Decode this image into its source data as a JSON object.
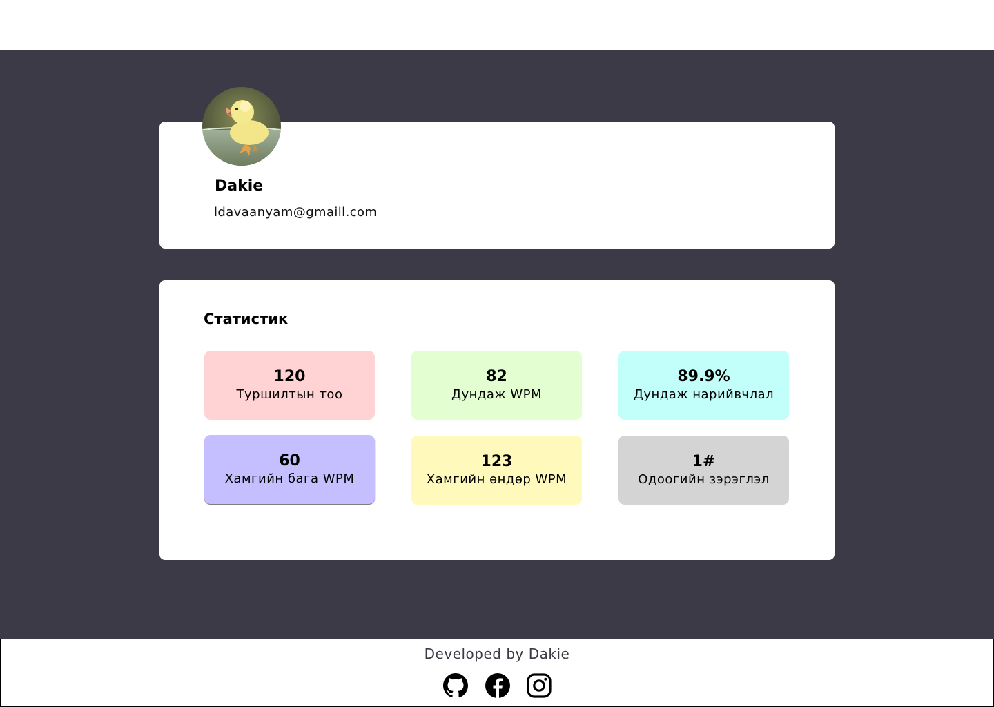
{
  "profile": {
    "avatar_icon": "duckling-photo",
    "name": "Dakie",
    "email": "ldavaanyam@gmaill.com"
  },
  "stats": {
    "title": "Статистик",
    "tiles": [
      {
        "value": "120",
        "label": "Туршилтын тоо",
        "color": "#ffd3d3"
      },
      {
        "value": "82",
        "label": "Дундаж WPM",
        "color": "#e3ffd2"
      },
      {
        "value": "89.9%",
        "label": "Дундаж нарийвчлал",
        "color": "#c3fffa"
      },
      {
        "value": "60",
        "label": "Хамгийн бага WPM",
        "color": "#c6bfff"
      },
      {
        "value": "123",
        "label": "Хамгийн өндөр WPM",
        "color": "#fffabc"
      },
      {
        "value": "1#",
        "label": "Одоогийн зэрэглэл",
        "color": "#d4d4d4"
      }
    ]
  },
  "footer": {
    "credit": "Developed by Dakie",
    "social_icons": [
      "github-icon",
      "facebook-icon",
      "instagram-icon"
    ]
  },
  "colors": {
    "background": "#3c3a47",
    "card": "#ffffff"
  }
}
